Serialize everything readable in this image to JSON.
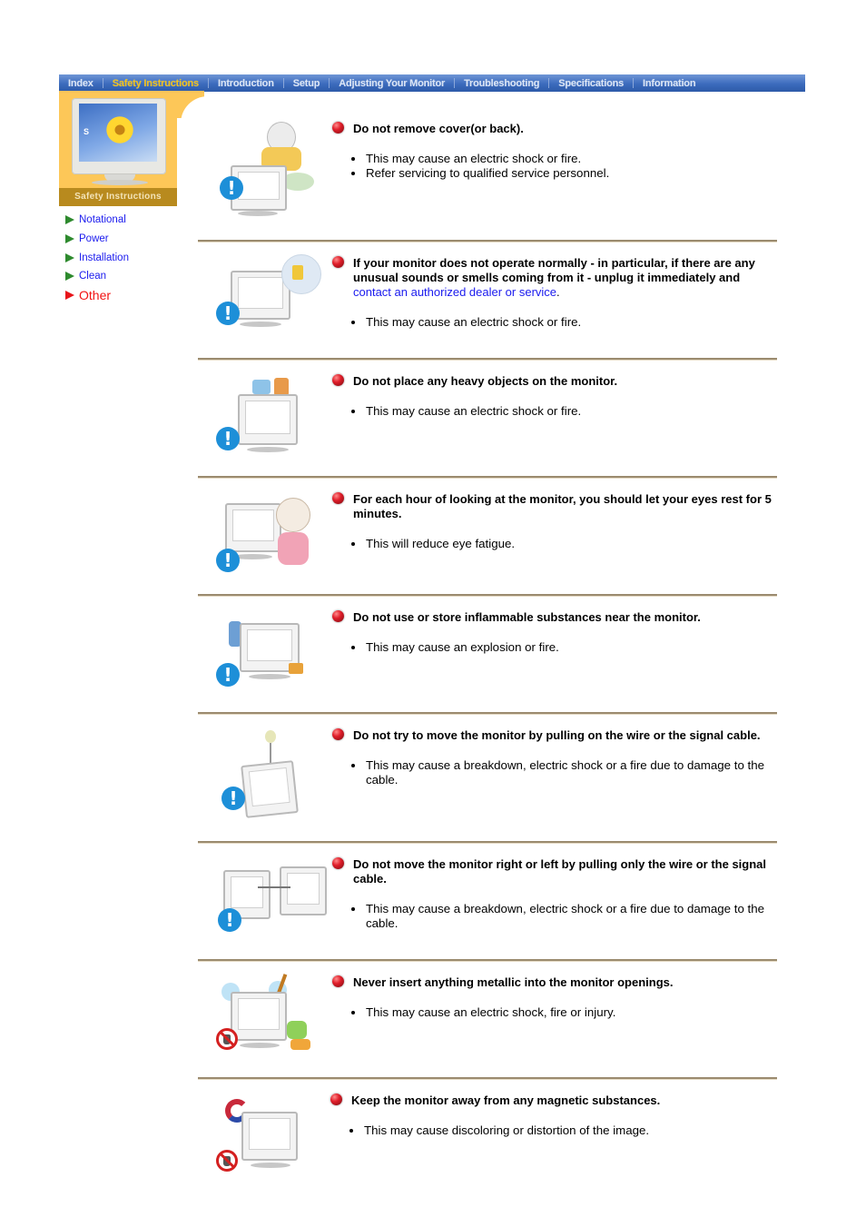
{
  "nav": {
    "items": [
      {
        "label": "Index",
        "active": false
      },
      {
        "label": "Safety Instructions",
        "active": true
      },
      {
        "label": "Introduction",
        "active": false
      },
      {
        "label": "Setup",
        "active": false
      },
      {
        "label": "Adjusting Your Monitor",
        "active": false
      },
      {
        "label": "Troubleshooting",
        "active": false
      },
      {
        "label": "Specifications",
        "active": false
      },
      {
        "label": "Information",
        "active": false
      }
    ]
  },
  "banner": {
    "title": "Safety Instructions",
    "monitor_letter": "S"
  },
  "sidebar": {
    "items": [
      {
        "label": "Notational",
        "active": false
      },
      {
        "label": "Power",
        "active": false
      },
      {
        "label": "Installation",
        "active": false
      },
      {
        "label": "Clean",
        "active": false
      },
      {
        "label": "Other",
        "active": true
      }
    ]
  },
  "colors": {
    "nav_bg": "#3c6bbd",
    "nav_active": "#f2c21b",
    "banner": "#fdc758",
    "banner_strip": "#b88a1e",
    "link": "#1a1aee",
    "active_item": "#f21212",
    "divider": "#9b8b6f"
  },
  "sections": [
    {
      "heading": "Do not remove cover(or back).",
      "bullets": [
        "This may cause an electric shock or fire.",
        "Refer servicing to qualified service personnel."
      ],
      "icon": "warning-icon"
    },
    {
      "heading": "If your monitor does not operate normally - in particular, if there are any unusual sounds or smells coming from it - unplug it immediately and",
      "link": "contact an authorized dealer or service",
      "heading_suffix": ".",
      "bullets": [
        "This may cause an electric shock or fire."
      ],
      "icon": "warning-icon"
    },
    {
      "heading": "Do not place any heavy objects on the monitor.",
      "bullets": [
        "This may cause an electric shock or fire."
      ],
      "icon": "warning-icon"
    },
    {
      "heading": "For each hour of looking at the monitor, you should let your eyes rest for 5 minutes.",
      "bullets": [
        "This will reduce eye fatigue."
      ],
      "icon": "warning-icon"
    },
    {
      "heading": "Do not use or store inflammable substances near the monitor.",
      "bullets": [
        "This may cause an explosion or fire."
      ],
      "icon": "warning-icon"
    },
    {
      "heading": "Do not try to move the monitor by pulling on the wire or the signal cable.",
      "bullets": [
        "This may cause a breakdown, electric shock or a fire due to damage to the cable."
      ],
      "icon": "warning-icon"
    },
    {
      "heading": "Do not move the monitor right or left by pulling only the wire or the signal cable.",
      "bullets": [
        "This may cause a breakdown, electric shock or a fire due to damage to the cable."
      ],
      "icon": "warning-icon"
    },
    {
      "heading": "Never insert anything metallic into the monitor openings.",
      "bullets": [
        "This may cause an electric shock, fire or injury."
      ],
      "icon": "prohibited-icon"
    },
    {
      "heading": "Keep the monitor away from any magnetic substances.",
      "bullets": [
        "This may cause discoloring or distortion of the image."
      ],
      "icon": "prohibited-icon"
    }
  ]
}
